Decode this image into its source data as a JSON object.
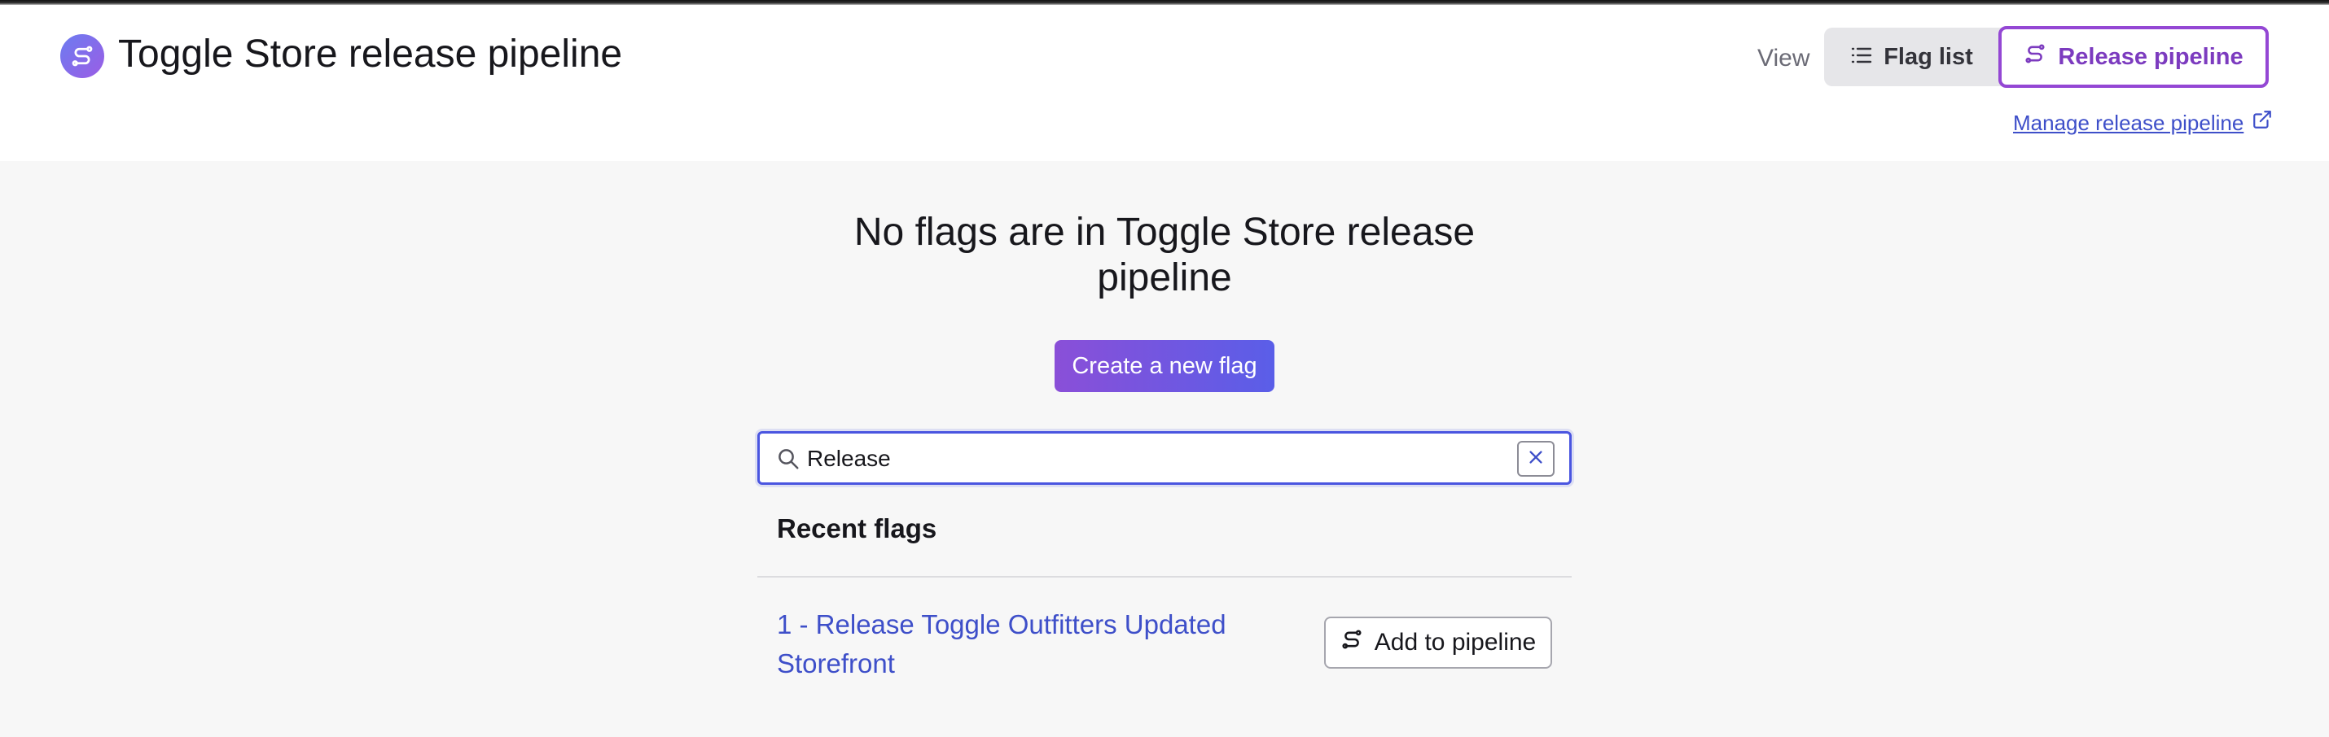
{
  "header": {
    "title": "Toggle Store release pipeline",
    "view_label": "View",
    "view_toggle": {
      "flag_list_label": "Flag list",
      "release_pipeline_label": "Release pipeline",
      "selected": "Release pipeline"
    },
    "manage_link": "Manage release pipeline"
  },
  "empty_state": {
    "heading": "No flags are in Toggle Store release pipeline",
    "create_button": "Create a new flag"
  },
  "search": {
    "value": "Release"
  },
  "recent_flags": {
    "heading": "Recent flags",
    "items": [
      {
        "name": "1 - Release Toggle Outfitters Updated Storefront",
        "action_label": "Add to pipeline"
      }
    ]
  },
  "colors": {
    "accent_purple": "#9447d4",
    "link_blue": "#3e4fc9",
    "focus_blue": "#4a55e0"
  },
  "icons": {
    "app": "pipeline-icon",
    "flag_list": "list-icon",
    "release_pipeline": "pipeline-icon",
    "manage_link": "external-link-icon",
    "search": "search-icon",
    "clear": "close-icon",
    "add": "pipeline-icon"
  }
}
